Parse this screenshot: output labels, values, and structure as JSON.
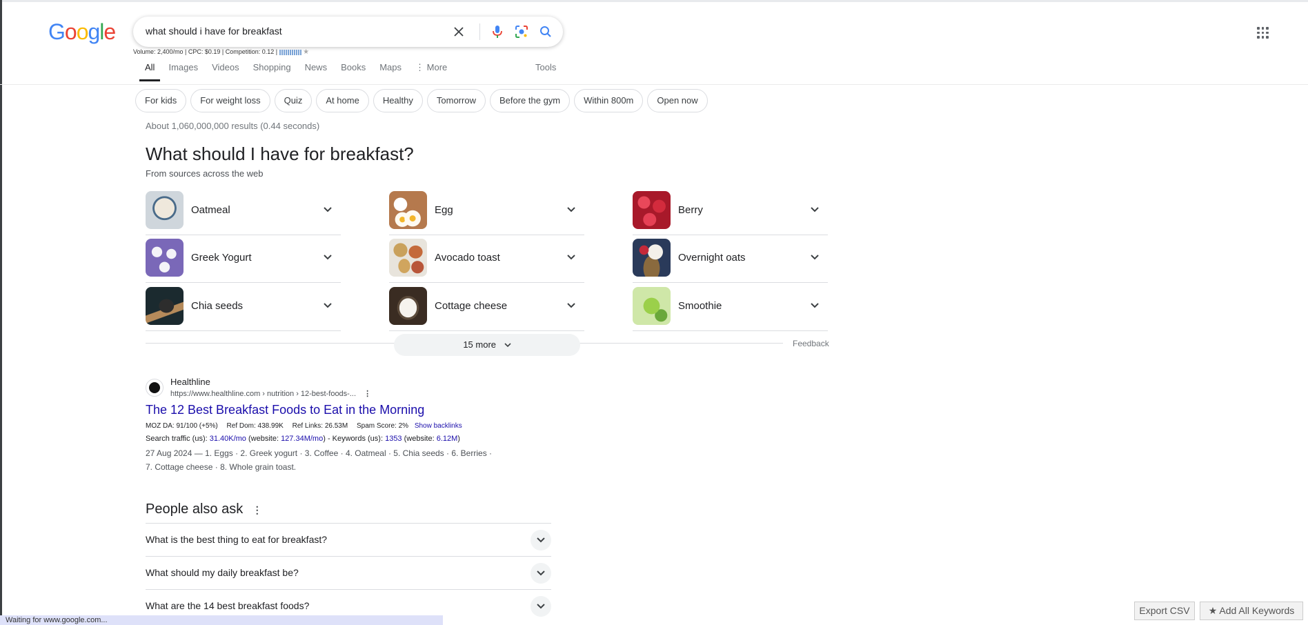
{
  "logo": {
    "g1": "G",
    "o1": "o",
    "o2": "o",
    "g2": "g",
    "l": "l",
    "e": "e"
  },
  "search": {
    "query": "what should i have for breakfast",
    "seo_line": "Volume: 2,400/mo | CPC: $0.19 | Competition: 0.12 |"
  },
  "tabs": [
    "All",
    "Images",
    "Videos",
    "Shopping",
    "News",
    "Books",
    "Maps",
    "More"
  ],
  "tools_label": "Tools",
  "chips": [
    "For kids",
    "For weight loss",
    "Quiz",
    "At home",
    "Healthy",
    "Tomorrow",
    "Before the gym",
    "Within 800m",
    "Open now"
  ],
  "results_count": "About 1,060,000,000 results (0.44 seconds)",
  "featured": {
    "heading": "What should I have for breakfast?",
    "subheading": "From sources across the web",
    "items": [
      "Oatmeal",
      "Egg",
      "Berry",
      "Greek Yogurt",
      "Avocado toast",
      "Overnight oats",
      "Chia seeds",
      "Cottage cheese",
      "Smoothie"
    ],
    "more_label": "15 more",
    "feedback": "Feedback"
  },
  "result": {
    "site_name": "Healthline",
    "url": "https://www.healthline.com › nutrition › 12-best-foods-...",
    "title": "The 12 Best Breakfast Foods to Eat in the Morning",
    "moz": "MOZ DA: 91/100 (+5%)",
    "ref_dom": "Ref Dom: 438.99K",
    "ref_links": "Ref Links: 26.53M",
    "spam": "Spam Score: 2%",
    "backlinks": "Show backlinks",
    "traffic_prefix": "Search traffic (us): ",
    "traffic_value": "31.40K/mo",
    "website_prefix": " (website: ",
    "website_value": "127.34M/mo",
    "keywords_prefix": ") - Keywords (us): ",
    "keywords_value": "1353",
    "keywords_site_prefix": " (website: ",
    "keywords_site_value": "6.12M",
    "traffic_suffix": ")",
    "snippet_line1": "27 Aug 2024 — 1. Eggs · 2. Greek yogurt · 3. Coffee · 4. Oatmeal · 5. Chia seeds · 6. Berries ·",
    "snippet_line2": "7. Cottage cheese · 8. Whole grain toast."
  },
  "paa": {
    "title": "People also ask",
    "questions": [
      "What is the best thing to eat for breakfast?",
      "What should my daily breakfast be?",
      "What are the 14 best breakfast foods?"
    ]
  },
  "buttons": {
    "export": "Export CSV",
    "add_all": "★ Add All Keywords"
  },
  "status_text": "Waiting for www.google.com..."
}
